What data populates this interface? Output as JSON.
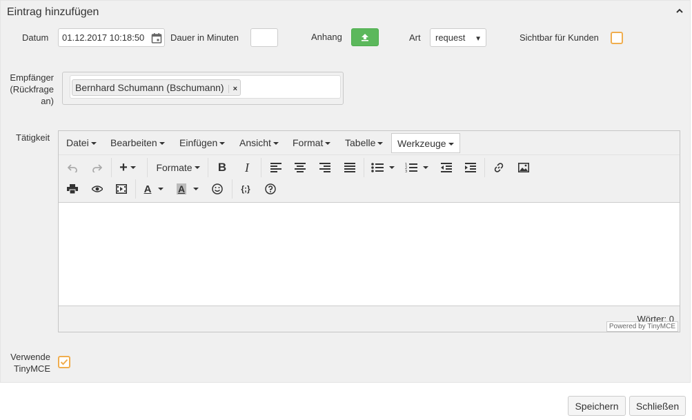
{
  "panel": {
    "title": "Eintrag hinzufügen"
  },
  "form": {
    "datum_label": "Datum",
    "datum_value": "01.12.2017 10:18:50",
    "dauer_label": "Dauer in Minuten",
    "dauer_value": "",
    "anhang_label": "Anhang",
    "art_label": "Art",
    "art_value": "request",
    "sichtbar_label": "Sichtbar für Kunden",
    "sichtbar_checked": false,
    "empfaenger_label_1": "Empfänger",
    "empfaenger_label_2": "(Rückfrage",
    "empfaenger_label_3": "an)",
    "empfaenger_tag": "Bernhard Schumann (Bschumann)",
    "empfaenger_tag_remove": "×",
    "taetigkeit_label": "Tätigkeit",
    "tinymce_label_1": "Verwende",
    "tinymce_label_2": "TinyMCE",
    "tinymce_checked": true
  },
  "editor": {
    "menus": [
      "Datei",
      "Bearbeiten",
      "Einfügen",
      "Ansicht",
      "Format",
      "Tabelle",
      "Werkzeuge"
    ],
    "active_menu": "Werkzeuge",
    "formats_label": "Formate",
    "word_count": "Wörter: 0",
    "powered_by": "Powered by TinyMCE"
  },
  "footer": {
    "save_label": "Speichern",
    "close_label": "Schließen"
  },
  "colors": {
    "accent_green": "#5cb85c",
    "checkbox_orange": "#f0ad4e"
  }
}
